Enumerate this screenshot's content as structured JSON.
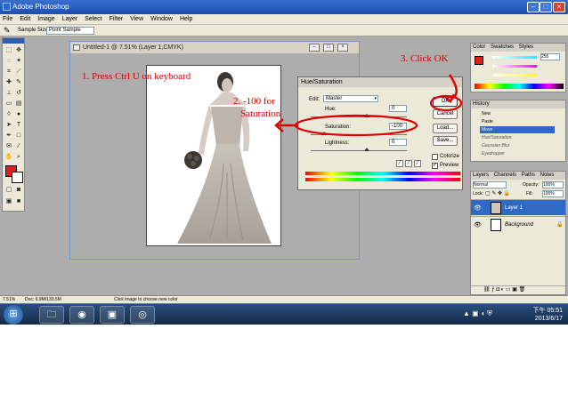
{
  "app": {
    "title": "Adobe Photoshop"
  },
  "menu": [
    "File",
    "Edit",
    "Image",
    "Layer",
    "Select",
    "Filter",
    "View",
    "Window",
    "Help"
  ],
  "options": {
    "label": "Sample Size:",
    "value": "Point Sample"
  },
  "document": {
    "title": "Untitled-1 @ 7.51% (Layer 1,CMYK)"
  },
  "dialog": {
    "title": "Hue/Saturation",
    "edit_label": "Edit:",
    "edit_value": "Master",
    "hue_label": "Hue:",
    "hue_value": "0",
    "saturation_label": "Saturation:",
    "saturation_value": "-100",
    "lightness_label": "Lightness:",
    "lightness_value": "0",
    "ok": "OK",
    "cancel": "Cancel",
    "load": "Load...",
    "save": "Save...",
    "colorize": "Colorize",
    "preview": "Preview",
    "preview_checked": true,
    "colorize_checked": false,
    "saturation_level": -100
  },
  "annotations": {
    "step1": "1. Press Ctrl U on keyboard",
    "step2a": "2. -100 for",
    "step2b": "Saturation",
    "step3": "3. Click OK"
  },
  "color_panel": {
    "tabs": [
      "Color",
      "Swatches",
      "Styles"
    ],
    "c_value": "255",
    "foreground": "#e41c1c"
  },
  "history_panel": {
    "tab": "History",
    "items": [
      "New",
      "Paste",
      "Move",
      "Hue/Saturation",
      "Gaussian Blur",
      "Eyedropper"
    ],
    "active_index": 2
  },
  "layers_panel": {
    "tabs": [
      "Layers",
      "Channels",
      "Paths",
      "Notes"
    ],
    "blend_mode": "Normal",
    "opacity_label": "Opacity:",
    "opacity_value": "100%",
    "lock_label": "Lock:",
    "fill_label": "Fill:",
    "fill_value": "100%",
    "layers": [
      "Layer 1",
      "Background"
    ],
    "active_layer": 0
  },
  "statusbar": {
    "zoom": "7.51%",
    "doc": "Doc: 9.9M/133.5M",
    "hint": "Click image to choose new color"
  },
  "taskbar": {
    "time": "下午 05:51",
    "date": "2013/6/17"
  }
}
